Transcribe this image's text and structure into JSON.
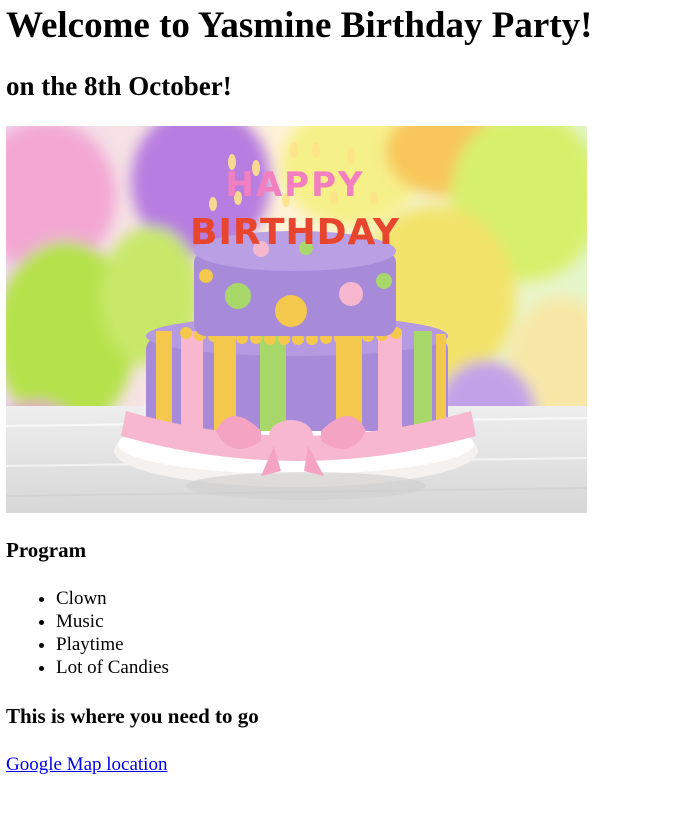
{
  "header": {
    "title": "Welcome to Yasmine Birthday Party!",
    "subtitle": "on the 8th October!"
  },
  "image": {
    "cake_text_top": "HAPPY",
    "cake_text_bottom": "BIRTHDAY"
  },
  "program": {
    "heading": "Program",
    "items": [
      "Clown",
      "Music",
      "Playtime",
      "Lot of Candies"
    ]
  },
  "directions": {
    "heading": "This is where you need to go",
    "link_label": "Google Map location"
  },
  "colors": {
    "link": "#0000ee",
    "text": "#000000",
    "cake_purple": "#a78bd8",
    "cake_pink": "#f7b8cf",
    "cake_yellow": "#f3c84c",
    "cake_green": "#a9d86a"
  }
}
